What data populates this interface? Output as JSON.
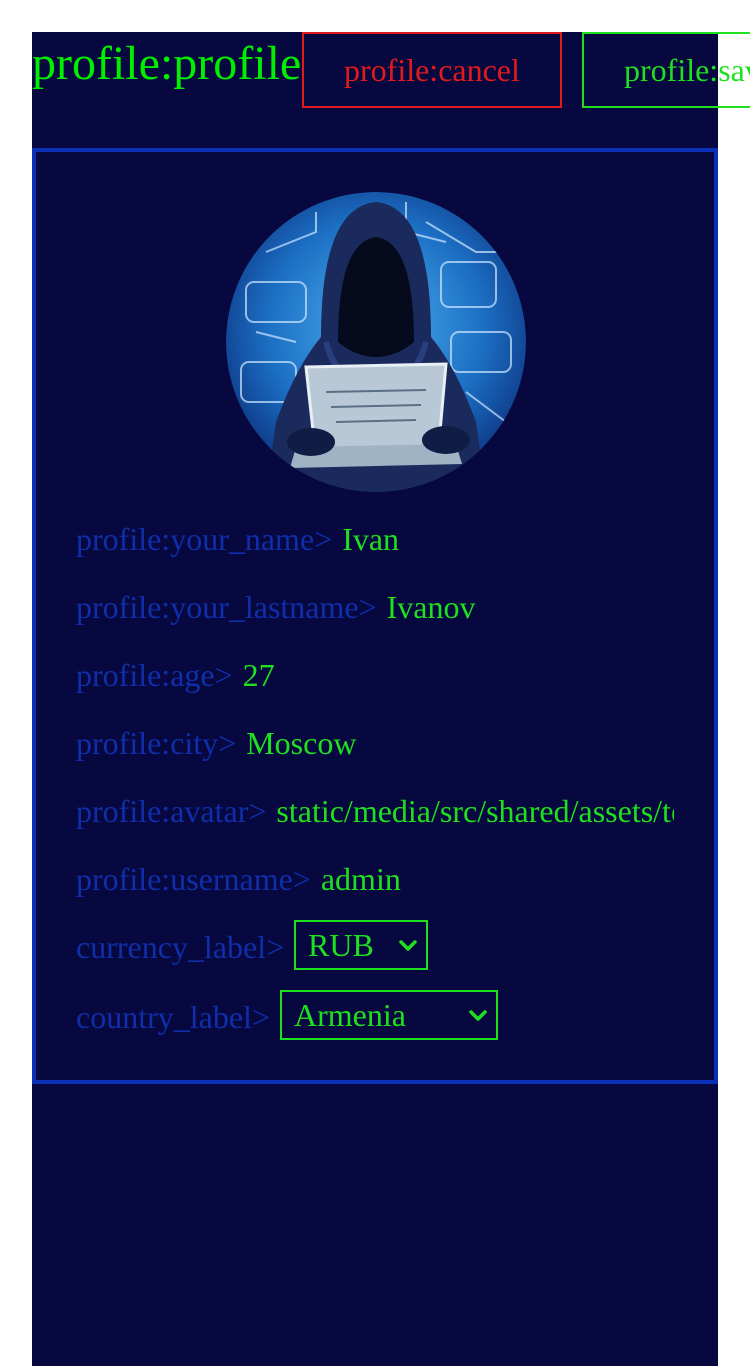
{
  "header": {
    "title": "profile:profile",
    "cancel_label": "profile:cancel",
    "save_label": "profile:save"
  },
  "profile": {
    "avatar_icon": "hacker-avatar-icon",
    "fields": {
      "name": {
        "label": "profile:your_name>",
        "value": "Ivan"
      },
      "lastname": {
        "label": "profile:your_lastname>",
        "value": "Ivanov"
      },
      "age": {
        "label": "profile:age>",
        "value": "27"
      },
      "city": {
        "label": "profile:city>",
        "value": "Moscow"
      },
      "avatar": {
        "label": "profile:avatar>",
        "value": "static/media/src/shared/assets/te"
      },
      "username": {
        "label": "profile:username>",
        "value": "admin"
      }
    },
    "currency": {
      "label": "currency_label>",
      "selected": "RUB"
    },
    "country": {
      "label": "country_label>",
      "selected": "Armenia"
    }
  },
  "colors": {
    "background": "#070840",
    "accent_green": "#1fe01f",
    "cancel_red": "#e01b1b",
    "label_blue": "#0f2eaa",
    "card_border": "#0a2fb8"
  }
}
